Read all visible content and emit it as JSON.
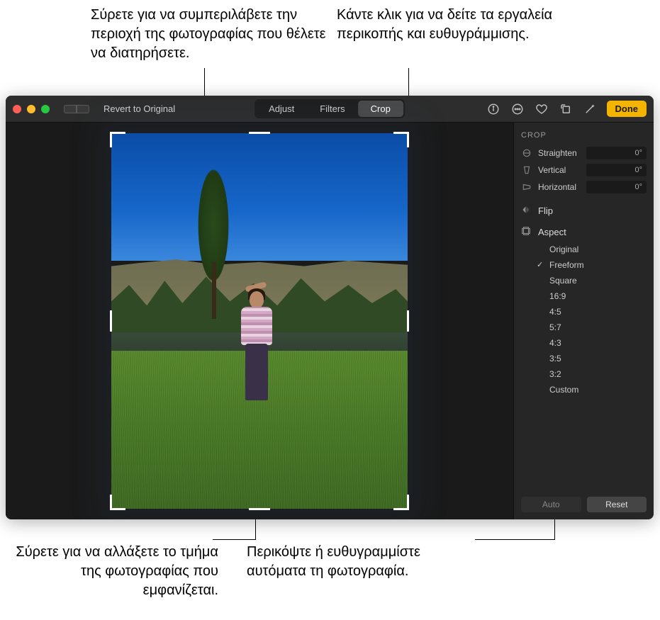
{
  "callouts": {
    "top_left": "Σύρετε για να συμπεριλάβετε την περιοχή της φωτογραφίας που θέλετε να διατηρήσετε.",
    "top_right": "Κάντε κλικ για να δείτε τα εργαλεία περικοπής και ευθυγράμμισης.",
    "bottom_left": "Σύρετε για να αλλάξετε το τμήμα της φωτογραφίας που εμφανίζεται.",
    "bottom_right": "Περικόψτε ή ευθυγραμμίστε αυτόματα τη φωτογραφία."
  },
  "toolbar": {
    "revert": "Revert to Original",
    "tabs": {
      "adjust": "Adjust",
      "filters": "Filters",
      "crop": "Crop"
    },
    "done": "Done"
  },
  "panel": {
    "title": "CROP",
    "sliders": {
      "straighten": {
        "label": "Straighten",
        "value": "0°"
      },
      "vertical": {
        "label": "Vertical",
        "value": "0°"
      },
      "horizontal": {
        "label": "Horizontal",
        "value": "0°"
      }
    },
    "flip_label": "Flip",
    "aspect_label": "Aspect",
    "aspects": [
      "Original",
      "Freeform",
      "Square",
      "16:9",
      "4:5",
      "5:7",
      "4:3",
      "3:5",
      "3:2",
      "Custom"
    ],
    "selected_aspect": "Freeform",
    "auto": "Auto",
    "reset": "Reset"
  }
}
